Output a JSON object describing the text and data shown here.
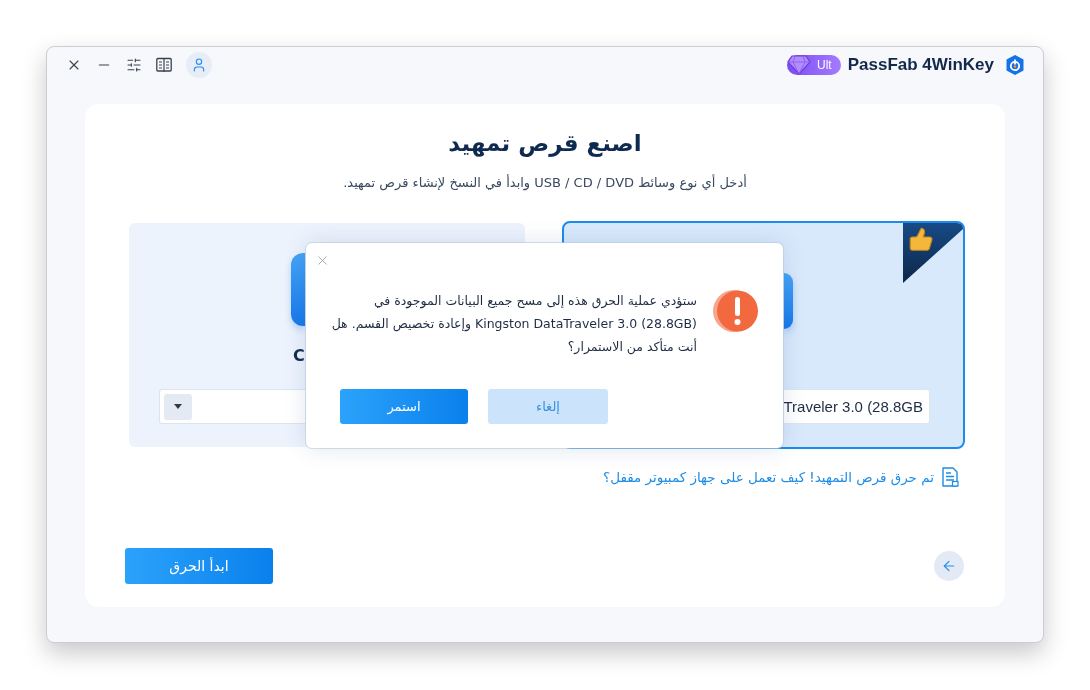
{
  "app": {
    "edition": "Ult",
    "name": "PassFab 4WinKey"
  },
  "page": {
    "title": "اصنع قرص تمهيد",
    "subtitle": "أدخل أي نوع وسائط USB / CD / DVD وابدأ في النسخ لإنشاء قرص تمهيد."
  },
  "media_options": [
    {
      "label": "C",
      "selected": false
    },
    {
      "value": "Traveler 3.0 (28.8GB",
      "selected": true
    }
  ],
  "help_link": "تم حرق قرص التمهيد! كيف تعمل على جهاز كمبيوتر مقفل؟",
  "start_button": "ابدأ الحرق",
  "dialog": {
    "message": "ستؤدي عملية الحرق هذه إلى مسح جميع البيانات الموجودة في Kingston DataTraveler 3.0 (28.8GB) وإعادة تخصيص القسم. هل أنت متأكد من الاستمرار؟",
    "buttons": [
      {
        "label": "إلغاء",
        "kind": "secondary"
      },
      {
        "label": "استمر",
        "kind": "primary"
      }
    ]
  }
}
